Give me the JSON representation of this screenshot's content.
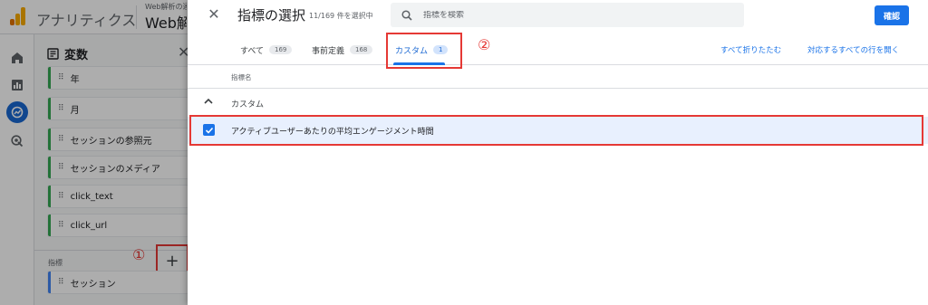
{
  "app": {
    "name": "アナリティクス",
    "property_sub": "Web解析の達",
    "property_name": "Web解"
  },
  "rail": {
    "icons": [
      "home-icon",
      "reports-icon",
      "explore-icon",
      "advertising-icon"
    ],
    "active": "explore-icon"
  },
  "variables_panel": {
    "title": "変数",
    "dimensions": [
      "年",
      "月",
      "セッションの参照元",
      "セッションのメディア",
      "click_text",
      "click_url"
    ],
    "metrics_label": "指標",
    "metrics": [
      "セッション"
    ],
    "add_button_label": "+"
  },
  "annotations": {
    "step1": "①",
    "step2": "②"
  },
  "dialog": {
    "close_label": "✕",
    "title": "指標の選択",
    "selected_count": "11/169 件を選択中",
    "search_placeholder": "指標を検索",
    "confirm_label": "確認",
    "tabs": [
      {
        "label": "すべて",
        "count": "169"
      },
      {
        "label": "事前定義",
        "count": "168"
      },
      {
        "label": "カスタム",
        "count": "1",
        "active": true
      }
    ],
    "collapse_all_label": "すべて折りたたむ",
    "expand_all_label": "対応するすべての行を開く",
    "column_header": "指標名",
    "group_label": "カスタム",
    "metric_label": "アクティブユーザーあたりの平均エンゲージメント時間",
    "metric_checked": true
  },
  "colors": {
    "accent": "#1a73e8",
    "annotation_red": "#e53935",
    "selected_row_bg": "#e8f0fe"
  }
}
